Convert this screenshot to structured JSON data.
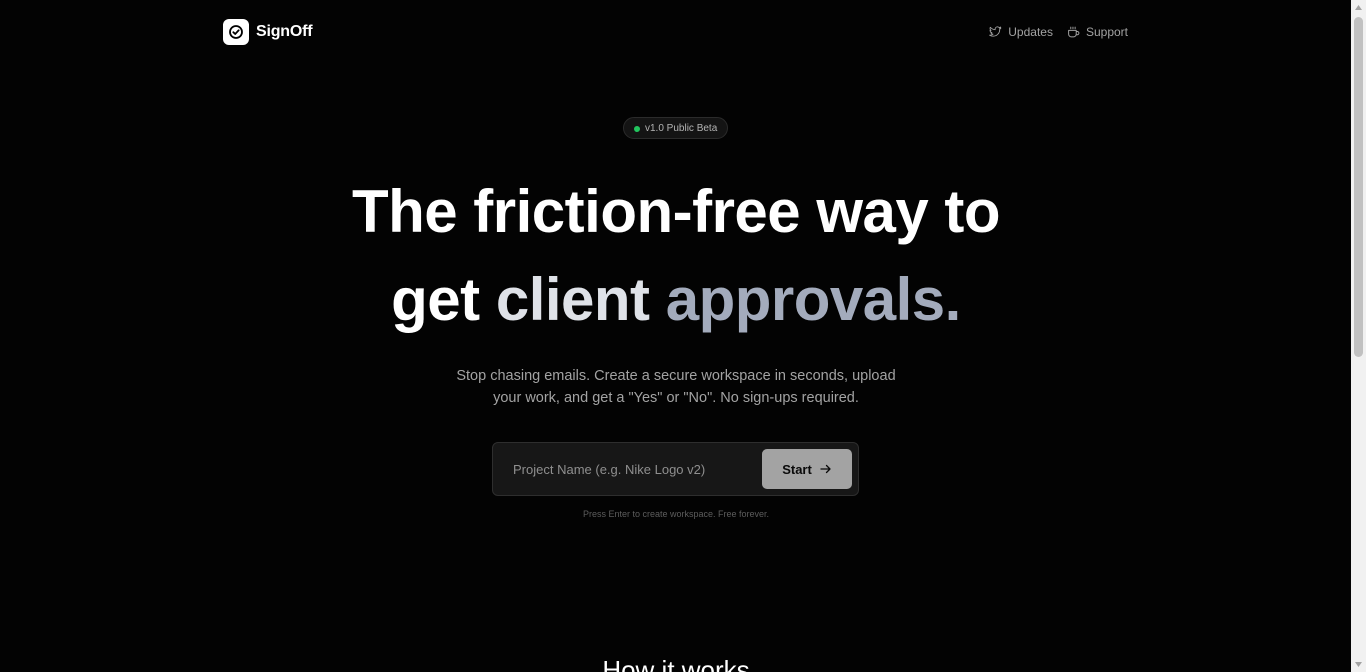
{
  "header": {
    "brand": "SignOff",
    "nav": [
      {
        "label": "Updates",
        "icon": "twitter-icon"
      },
      {
        "label": "Support",
        "icon": "coffee-icon"
      }
    ]
  },
  "hero": {
    "badge": "v1.0 Public Beta",
    "headline_line1": "The friction-free way to",
    "headline_get": "get",
    "headline_client": "client",
    "headline_approvals": "approvals.",
    "subtext_line1": "Stop chasing emails. Create a secure workspace in seconds, upload",
    "subtext_line2": "your work, and get a \"Yes\" or \"No\". No sign-ups required.",
    "input_placeholder": "Project Name (e.g. Nike Logo v2)",
    "input_value": "",
    "start_label": "Start",
    "hint": "Press Enter to create workspace. Free forever."
  },
  "section": {
    "title": "How it works"
  },
  "colors": {
    "background": "#030303",
    "badge_dot": "#22c55e",
    "accent_gray": "#a3abbc",
    "button": "#a3a3a3"
  }
}
